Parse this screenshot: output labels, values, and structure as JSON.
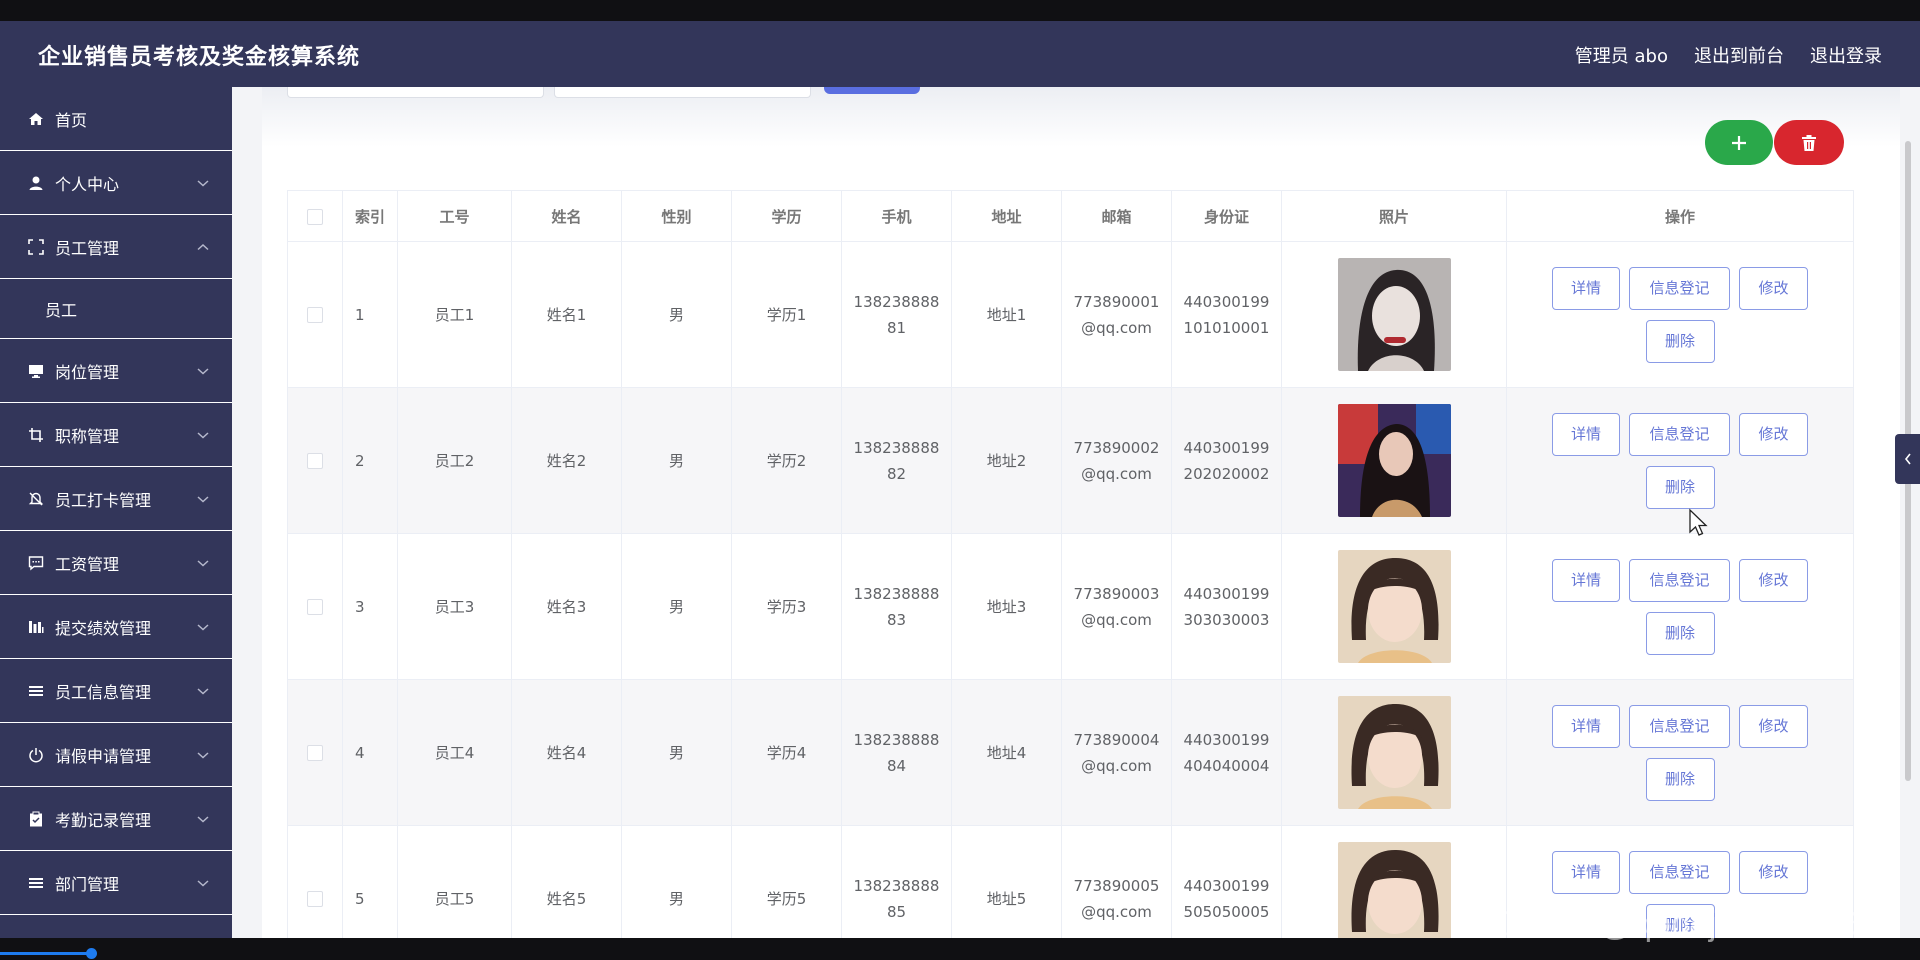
{
  "header": {
    "title": "企业销售员考核及奖金核算系统",
    "admin": "管理员 abo",
    "to_front": "退出到前台",
    "logout": "退出登录"
  },
  "sidebar": {
    "items": [
      {
        "label": "首页",
        "icon": "home-icon",
        "has_arrow": false,
        "expanded": false
      },
      {
        "label": "个人中心",
        "icon": "user-icon",
        "has_arrow": true,
        "expanded": false
      },
      {
        "label": "员工管理",
        "icon": "fullscreen-icon",
        "has_arrow": true,
        "expanded": true
      },
      {
        "label": "员工",
        "icon": "",
        "sub": true
      },
      {
        "label": "岗位管理",
        "icon": "monitor-icon",
        "has_arrow": true,
        "expanded": false
      },
      {
        "label": "职称管理",
        "icon": "crop-icon",
        "has_arrow": true,
        "expanded": false
      },
      {
        "label": "员工打卡管理",
        "icon": "bell-off-icon",
        "has_arrow": true,
        "expanded": false
      },
      {
        "label": "工资管理",
        "icon": "chat-icon",
        "has_arrow": true,
        "expanded": false
      },
      {
        "label": "提交绩效管理",
        "icon": "bar-chart-icon",
        "has_arrow": true,
        "expanded": false
      },
      {
        "label": "员工信息管理",
        "icon": "list-icon",
        "has_arrow": true,
        "expanded": false
      },
      {
        "label": "请假申请管理",
        "icon": "power-icon",
        "has_arrow": true,
        "expanded": false
      },
      {
        "label": "考勤记录管理",
        "icon": "clipboard-icon",
        "has_arrow": true,
        "expanded": false
      },
      {
        "label": "部门管理",
        "icon": "list-icon",
        "has_arrow": true,
        "expanded": false
      }
    ]
  },
  "toolbar": {
    "add_icon": "plus-icon",
    "delete_icon": "trash-icon"
  },
  "table": {
    "columns": [
      "索引",
      "工号",
      "姓名",
      "性别",
      "学历",
      "手机",
      "地址",
      "邮箱",
      "身份证",
      "照片",
      "操作"
    ],
    "rows": [
      {
        "index": "1",
        "emp_no": "员工1",
        "name": "姓名1",
        "gender": "男",
        "edu": "学历1",
        "phone_1": "138238888",
        "phone_2": "81",
        "address": "地址1",
        "email_1": "773890001",
        "email_2": "@qq.com",
        "id_1": "440300199",
        "id_2": "101010001"
      },
      {
        "index": "2",
        "emp_no": "员工2",
        "name": "姓名2",
        "gender": "男",
        "edu": "学历2",
        "phone_1": "138238888",
        "phone_2": "82",
        "address": "地址2",
        "email_1": "773890002",
        "email_2": "@qq.com",
        "id_1": "440300199",
        "id_2": "202020002"
      },
      {
        "index": "3",
        "emp_no": "员工3",
        "name": "姓名3",
        "gender": "男",
        "edu": "学历3",
        "phone_1": "138238888",
        "phone_2": "83",
        "address": "地址3",
        "email_1": "773890003",
        "email_2": "@qq.com",
        "id_1": "440300199",
        "id_2": "303030003"
      },
      {
        "index": "4",
        "emp_no": "员工4",
        "name": "姓名4",
        "gender": "男",
        "edu": "学历4",
        "phone_1": "138238888",
        "phone_2": "84",
        "address": "地址4",
        "email_1": "773890004",
        "email_2": "@qq.com",
        "id_1": "440300199",
        "id_2": "404040004"
      },
      {
        "index": "5",
        "emp_no": "员工5",
        "name": "姓名5",
        "gender": "男",
        "edu": "学历5",
        "phone_1": "138238888",
        "phone_2": "85",
        "address": "地址5",
        "email_1": "773890005",
        "email_2": "@qq.com",
        "id_1": "440300199",
        "id_2": "505050005"
      }
    ],
    "actions": {
      "detail": "详情",
      "register": "信息登记",
      "edit": "修改",
      "delete": "删除"
    }
  },
  "watermark": "CSDN @qodejava666666",
  "colors": {
    "header_bg": "#33365a",
    "sidebar_bg": "#33365a",
    "add_button": "#2aa84a",
    "delete_button": "#d8262e",
    "action_border": "#8a9be6"
  }
}
